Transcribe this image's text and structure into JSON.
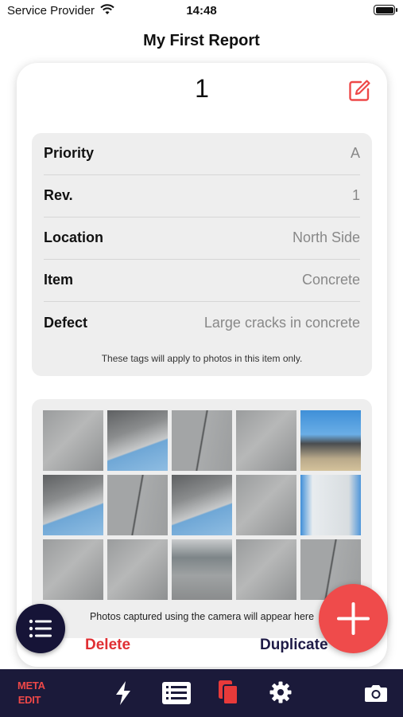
{
  "status_bar": {
    "carrier": "Service Provider",
    "time": "14:48",
    "wifi_icon": "wifi-icon",
    "battery_icon": "battery-icon"
  },
  "nav": {
    "title": "My First Report"
  },
  "item": {
    "number": "1",
    "edit_icon": "edit-icon",
    "tags": [
      {
        "label": "Priority",
        "value": "A"
      },
      {
        "label": "Rev.",
        "value": "1"
      },
      {
        "label": "Location",
        "value": "North Side"
      },
      {
        "label": "Item",
        "value": "Concrete"
      },
      {
        "label": "Defect",
        "value": "Large cracks in concrete"
      }
    ],
    "tags_note": "These tags will apply to photos in this item only."
  },
  "photos": {
    "note": "Photos captured using the camera will appear here",
    "thumbnails": [
      "concrete-floor-photo",
      "hangar-roof-photo",
      "concrete-crack-photo",
      "concrete-floor-photo",
      "blue-sky-shelter-photo",
      "hangar-roof-photo",
      "concrete-crack-photo",
      "hangar-roof-photo",
      "concrete-floor-photo",
      "white-wall-photo",
      "concrete-floor-photo",
      "concrete-floor-photo",
      "hangar-floor-photo",
      "concrete-floor-photo",
      "concrete-crack-photo"
    ]
  },
  "actions": {
    "delete": "Delete",
    "duplicate": "Duplicate"
  },
  "fab": {
    "list_icon": "list-icon",
    "add_icon": "plus-icon"
  },
  "toolbar": {
    "meta_line1": "META",
    "meta_line2": "EDIT",
    "icons": [
      "lightning-icon",
      "report-list-icon",
      "copy-pages-icon",
      "gear-icon",
      "camera-icon"
    ]
  },
  "colors": {
    "accent_red": "#ef4b4b",
    "navy": "#1b1a3a",
    "panel_gray": "#eeeeee"
  }
}
